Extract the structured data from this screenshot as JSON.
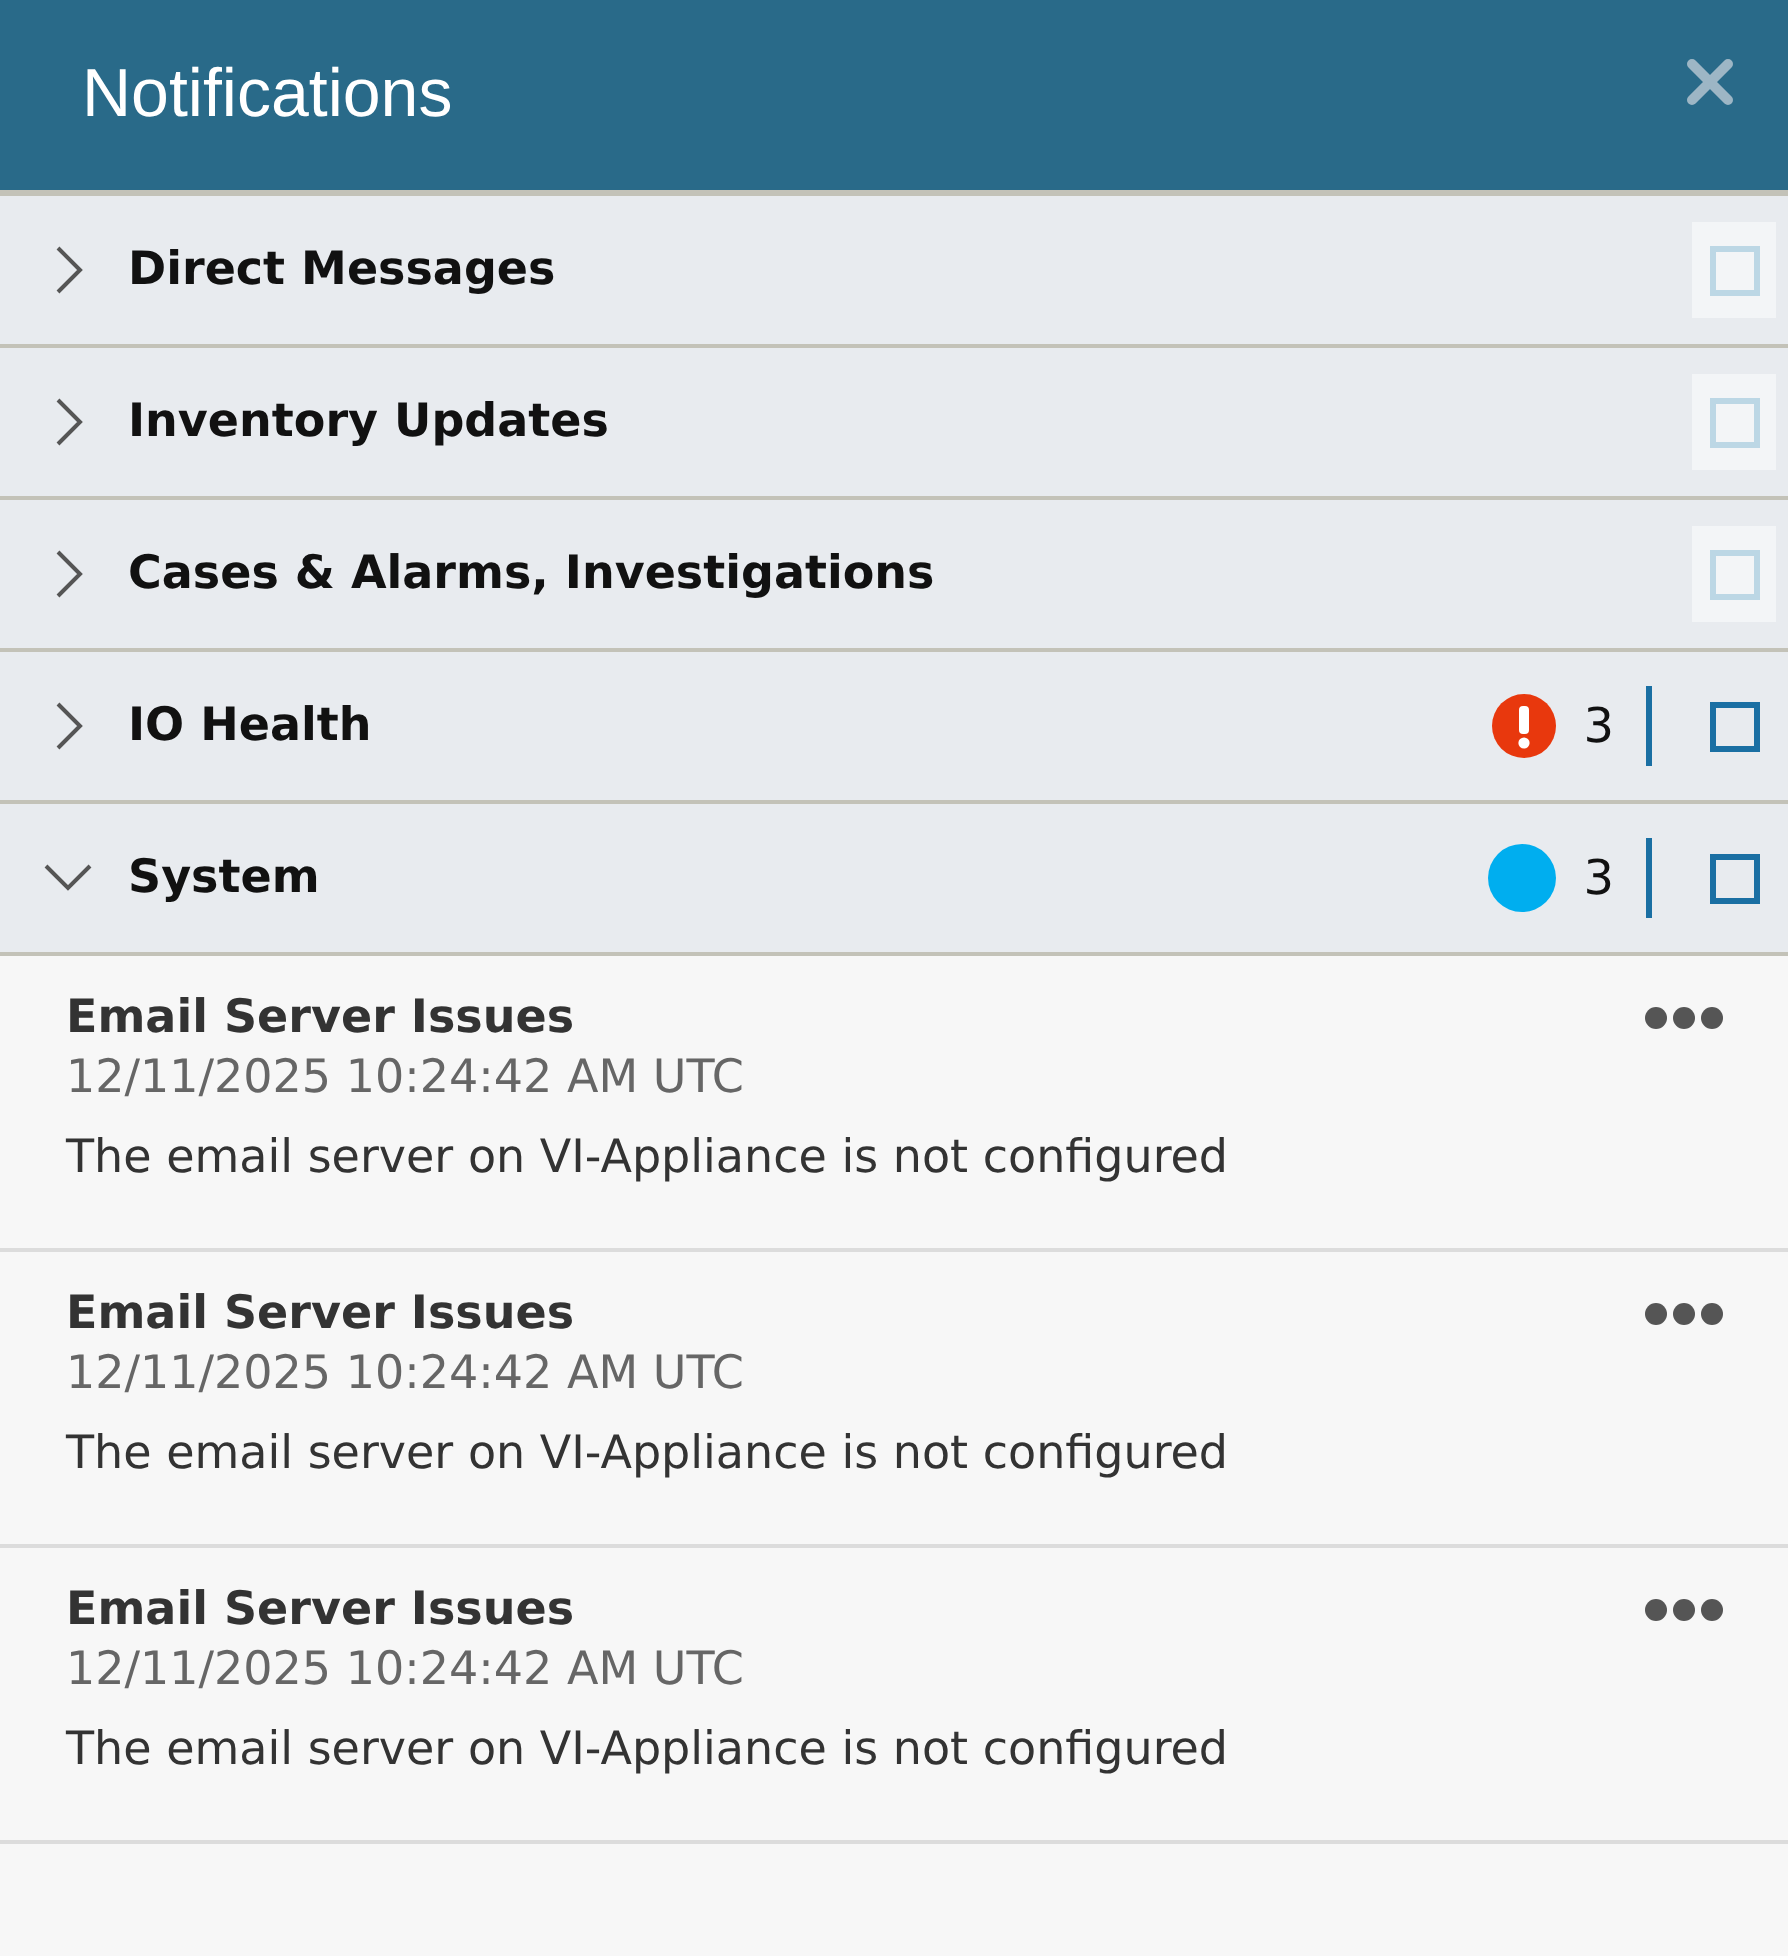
{
  "header": {
    "title": "Notifications"
  },
  "categories": [
    {
      "label": "Direct Messages",
      "expanded": false,
      "disabled": true
    },
    {
      "label": "Inventory Updates",
      "expanded": false,
      "disabled": true
    },
    {
      "label": "Cases & Alarms, Investigations",
      "expanded": false,
      "disabled": true
    },
    {
      "label": "IO Health",
      "expanded": false,
      "disabled": false,
      "badge": {
        "kind": "alert",
        "color": "#e8380d",
        "count": "3"
      }
    },
    {
      "label": "System",
      "expanded": true,
      "disabled": false,
      "badge": {
        "kind": "dot",
        "color": "#00aeef",
        "count": "3"
      }
    }
  ],
  "notifications": [
    {
      "title": "Email Server Issues",
      "time": "12/11/2025 10:24:42 AM UTC",
      "message": "The email server on VI-Appliance is not configured"
    },
    {
      "title": "Email Server Issues",
      "time": "12/11/2025 10:24:42 AM UTC",
      "message": "The email server on VI-Appliance is not configured"
    },
    {
      "title": "Email Server Issues",
      "time": "12/11/2025 10:24:42 AM UTC",
      "message": "The email server on VI-Appliance is not configured"
    }
  ]
}
